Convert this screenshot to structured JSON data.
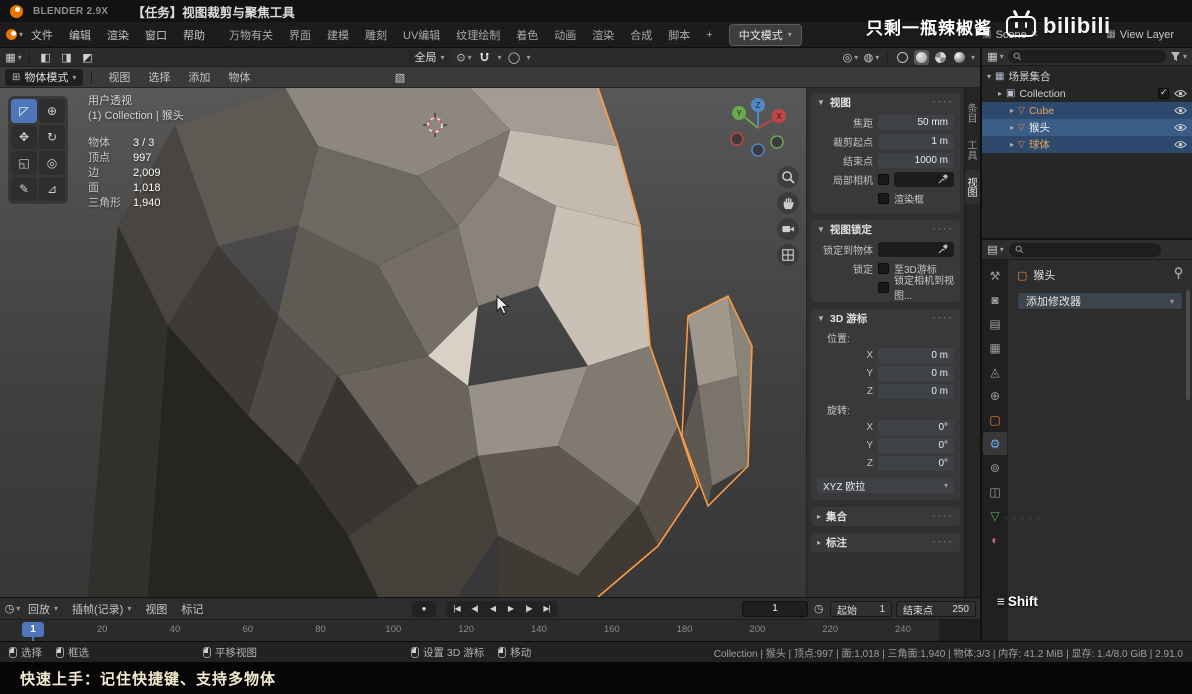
{
  "titlebar": {
    "app": "BLENDER 2.9X",
    "title": "【任务】视图裁剪与聚焦工具"
  },
  "watermark": {
    "text": "只剩一瓶辣椒酱",
    "logo": "bilibili"
  },
  "menubar": {
    "menus": [
      "文件",
      "编辑",
      "渲染",
      "窗口",
      "帮助"
    ],
    "workspaces": [
      "万物有关",
      "界面",
      "建模",
      "雕刻",
      "UV编辑",
      "纹理绘制",
      "着色",
      "动画",
      "渲染",
      "合成",
      "脚本",
      "+"
    ],
    "mode_tab": "中文模式",
    "scene": "Scene",
    "view_layer": "View Layer"
  },
  "viewport": {
    "header": {
      "orientation": "全局",
      "mode": "物体模式",
      "menus": [
        "视图",
        "选择",
        "添加",
        "物体"
      ]
    },
    "overlay": {
      "perspective": "用户透视",
      "context": "(1) Collection | 猴头",
      "stats": [
        {
          "label": "物体",
          "value": "3 / 3"
        },
        {
          "label": "顶点",
          "value": "997"
        },
        {
          "label": "边",
          "value": "2,009"
        },
        {
          "label": "面",
          "value": "1,018"
        },
        {
          "label": "三角形",
          "value": "1,940"
        }
      ]
    },
    "gizmo_axes": {
      "x": "X",
      "y": "Y",
      "z": "Z"
    }
  },
  "toolbar": {
    "active_index": 0,
    "tools": [
      {
        "name": "select-box-tool",
        "glyph": "◸"
      },
      {
        "name": "cursor-tool",
        "glyph": "⊕"
      },
      {
        "name": "move-tool",
        "glyph": "✥"
      },
      {
        "name": "rotate-tool",
        "glyph": "↻"
      },
      {
        "name": "scale-tool",
        "glyph": "◱"
      },
      {
        "name": "transform-tool",
        "glyph": "◎"
      },
      {
        "name": "annotate-tool",
        "glyph": "✎"
      },
      {
        "name": "measure-tool",
        "glyph": "⊿"
      }
    ]
  },
  "sidebar": {
    "tabs": [
      {
        "label": "条目",
        "cls": ""
      },
      {
        "label": "工具",
        "cls": ""
      },
      {
        "label": "视图",
        "cls": "active"
      }
    ],
    "view": {
      "title": "视图",
      "fields": [
        {
          "label": "焦距",
          "value": "50 mm"
        },
        {
          "label": "裁剪起点",
          "value": "1 m"
        },
        {
          "label": "结束点",
          "value": "1000 m"
        }
      ],
      "local_camera": "局部相机",
      "render_region": "渲染框"
    },
    "view_lock": {
      "title": "视图锁定",
      "lock_to_object": "锁定到物体",
      "lock": "锁定",
      "to_3d_cursor": "至3D游标",
      "lock_camera": "锁定相机到视图..."
    },
    "cursor3d": {
      "title": "3D 游标",
      "location_label": "位置:",
      "rotation_label": "旋转:",
      "location": [
        {
          "axis": "X",
          "value": "0 m"
        },
        {
          "axis": "Y",
          "value": "0 m"
        },
        {
          "axis": "Z",
          "value": "0 m"
        }
      ],
      "rotation": [
        {
          "axis": "X",
          "value": "0°"
        },
        {
          "axis": "Y",
          "value": "0°"
        },
        {
          "axis": "Z",
          "value": "0°"
        }
      ],
      "euler": "XYZ 欧拉"
    },
    "collapsed": [
      {
        "title": "集合"
      },
      {
        "title": "标注"
      }
    ]
  },
  "outliner": {
    "scene_collection": "场景集合",
    "collection": "Collection",
    "objects": [
      {
        "name": "Cube",
        "cls": "selected"
      },
      {
        "name": "猴头",
        "cls": "active"
      },
      {
        "name": "球体",
        "cls": "selected"
      }
    ]
  },
  "properties": {
    "object_name": "猴头",
    "add_modifier": "添加修改器",
    "tabs": [
      {
        "name": "tool-tab",
        "glyph": "⚒",
        "cls": ""
      },
      {
        "name": "render-tab",
        "glyph": "◙",
        "cls": ""
      },
      {
        "name": "output-tab",
        "glyph": "▤",
        "cls": ""
      },
      {
        "name": "view-layer-tab",
        "glyph": "▦",
        "cls": ""
      },
      {
        "name": "scene-tab",
        "glyph": "◬",
        "cls": ""
      },
      {
        "name": "world-tab",
        "glyph": "⊕",
        "cls": ""
      },
      {
        "name": "object-tab",
        "glyph": "▢",
        "cls": "orange"
      },
      {
        "name": "modifiers-tab",
        "glyph": "⚙",
        "cls": "blue active"
      },
      {
        "name": "physics-tab",
        "glyph": "⊚",
        "cls": ""
      },
      {
        "name": "constraints-tab",
        "glyph": "◫",
        "cls": ""
      },
      {
        "name": "object-data-tab",
        "glyph": "▽",
        "cls": "green"
      },
      {
        "name": "material-tab",
        "glyph": "◐",
        "cls": "pink"
      }
    ]
  },
  "timeline": {
    "menus": [
      {
        "label": "回放",
        "cls": ""
      },
      {
        "label": "插帧(记录)",
        "cls": ""
      },
      {
        "label": "视图",
        "cls": "no-caret"
      },
      {
        "label": "标记",
        "cls": "no-caret"
      }
    ],
    "transport": [
      {
        "name": "jump-start-button",
        "glyph": "|◀"
      },
      {
        "name": "prev-keyframe-button",
        "glyph": "◀|"
      },
      {
        "name": "play-reverse-button",
        "glyph": "◀"
      },
      {
        "name": "play-button",
        "glyph": "▶"
      },
      {
        "name": "next-keyframe-button",
        "glyph": "|▶"
      },
      {
        "name": "jump-end-button",
        "glyph": "▶|"
      }
    ],
    "current_frame": "1",
    "start_label": "起始",
    "start_value": "1",
    "end_label": "结束点",
    "end_value": "250",
    "ticks": [
      20,
      40,
      60,
      80,
      100,
      120,
      140,
      160,
      180,
      200,
      220,
      240
    ]
  },
  "statusbar": {
    "hints": [
      {
        "label": "选择",
        "cls": ""
      },
      {
        "label": "框选",
        "cls": "gap-lg"
      },
      {
        "label": "平移视图",
        "cls": "gap-xl"
      },
      {
        "label": "设置 3D 游标",
        "cls": ""
      },
      {
        "label": "移动",
        "cls": ""
      }
    ],
    "info": "Collection | 猴头 | 顶点:997 | 面:1,018 | 三角面:1,940 | 物体:3/3 | 内存: 41.2 MiB | 显存: 1.4/8.0 GiB | 2.91.0"
  },
  "banner": {
    "text": "快速上手：记住快捷键、支持多物体"
  },
  "screencast": {
    "key": "Shift"
  },
  "colors": {
    "accent": "#4772b3",
    "selection_outline": "#ff9d45",
    "object_orange": "#e8853a"
  }
}
